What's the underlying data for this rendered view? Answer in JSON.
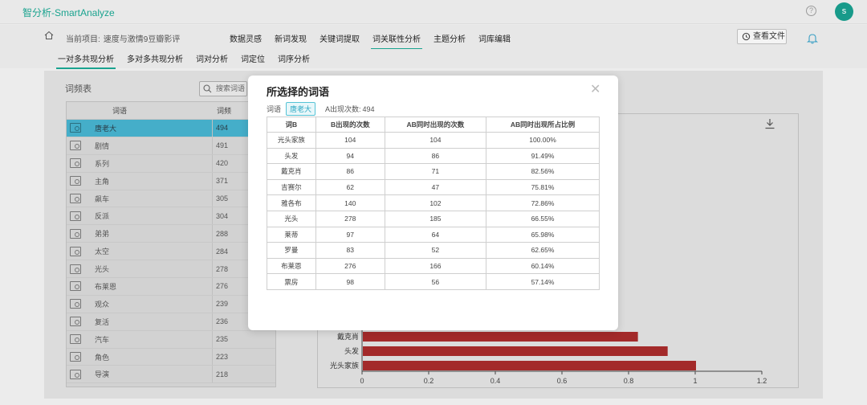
{
  "app": {
    "title": "智分析-SmartAnalyze",
    "avatar_letter": "s"
  },
  "nav": {
    "project_label": "当前项目:",
    "project_name": "速度与激情9豆瓣影评",
    "tabs": [
      {
        "label": "数据灵感"
      },
      {
        "label": "新词发现"
      },
      {
        "label": "关键词提取"
      },
      {
        "label": "词关联性分析",
        "active": true
      },
      {
        "label": "主题分析"
      },
      {
        "label": "词库编辑"
      }
    ],
    "view_file_label": "查看文件"
  },
  "subtabs": [
    {
      "label": "一对多共现分析",
      "active": true
    },
    {
      "label": "多对多共现分析"
    },
    {
      "label": "词对分析"
    },
    {
      "label": "词定位"
    },
    {
      "label": "词序分析"
    }
  ],
  "word_panel": {
    "title": "词频表",
    "search_placeholder": "搜索词语",
    "col_word": "词语",
    "col_freq": "词频",
    "rows": [
      {
        "word": "唐老大",
        "freq": "494",
        "selected": true
      },
      {
        "word": "剧情",
        "freq": "491"
      },
      {
        "word": "系列",
        "freq": "420"
      },
      {
        "word": "主角",
        "freq": "371"
      },
      {
        "word": "飙车",
        "freq": "305"
      },
      {
        "word": "反派",
        "freq": "304"
      },
      {
        "word": "弟弟",
        "freq": "288"
      },
      {
        "word": "太空",
        "freq": "284"
      },
      {
        "word": "光头",
        "freq": "278"
      },
      {
        "word": "布莱恩",
        "freq": "276"
      },
      {
        "word": "观众",
        "freq": "239"
      },
      {
        "word": "复活",
        "freq": "236"
      },
      {
        "word": "汽车",
        "freq": "235"
      },
      {
        "word": "角色",
        "freq": "223"
      },
      {
        "word": "导演",
        "freq": "218"
      }
    ]
  },
  "chart_data": {
    "type": "bar",
    "orientation": "horizontal",
    "categories": [
      "光头家族",
      "头发",
      "戴克肖",
      "吉赛尔"
    ],
    "values": [
      1.0,
      0.9149,
      0.8256,
      0.7581
    ],
    "xlim": [
      0,
      1.2
    ],
    "xticks": [
      "0",
      "0.2",
      "0.4",
      "0.6",
      "0.8",
      "1",
      "1.2"
    ],
    "bar_color": "#a32a2a"
  },
  "modal": {
    "title": "所选择的词语",
    "word_label": "词语",
    "word_value": "唐老大",
    "count_label": "A出现次数:",
    "count_value": "494",
    "headers": [
      "词B",
      "B出现的次数",
      "AB同时出现的次数",
      "AB同时出现所占比例"
    ],
    "rows": [
      [
        "光头家族",
        "104",
        "104",
        "100.00%"
      ],
      [
        "头发",
        "94",
        "86",
        "91.49%"
      ],
      [
        "戴克肖",
        "86",
        "71",
        "82.56%"
      ],
      [
        "吉赛尔",
        "62",
        "47",
        "75.81%"
      ],
      [
        "雅各布",
        "140",
        "102",
        "72.86%"
      ],
      [
        "光头",
        "278",
        "185",
        "66.55%"
      ],
      [
        "莱蒂",
        "97",
        "64",
        "65.98%"
      ],
      [
        "罗曼",
        "83",
        "52",
        "62.65%"
      ],
      [
        "布莱恩",
        "276",
        "166",
        "60.14%"
      ],
      [
        "票房",
        "98",
        "56",
        "57.14%"
      ]
    ]
  }
}
